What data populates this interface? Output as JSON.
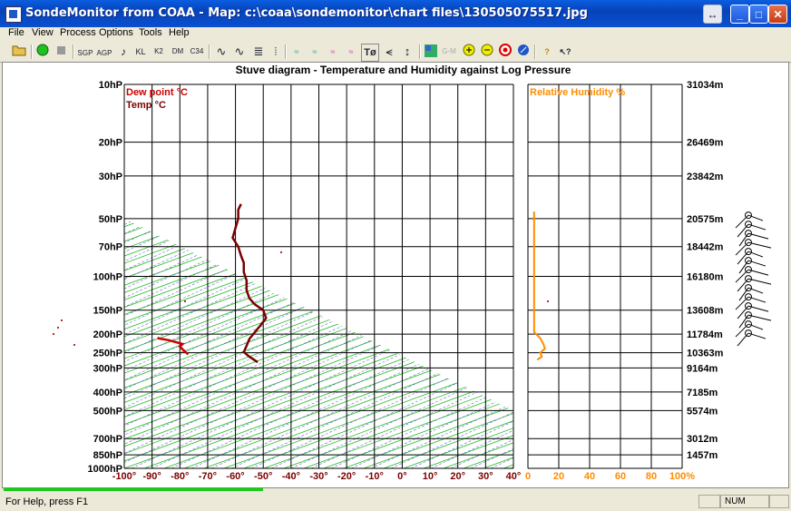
{
  "window": {
    "title": "SondeMonitor from COAA - Map: c:\\coaa\\sondemonitor\\chart files\\130505075517.jpg",
    "controls": {
      "restore": "↔",
      "minimize": "_",
      "maximize": "□",
      "close": "✕"
    }
  },
  "menu": [
    "File",
    "View",
    "Process",
    "Options",
    "Tools",
    "Help"
  ],
  "toolbar": {
    "items": [
      "open-icon",
      "start-icon",
      "stop-icon",
      "sgp-icon",
      "agp-icon",
      "sound-icon",
      "kl-icon",
      "k2-icon",
      "dm-icon",
      "c34-icon",
      "wave-icon",
      "wave2-icon",
      "lines-icon",
      "vbars-icon",
      "plot1-icon",
      "plot2-icon",
      "plot3-icon",
      "plot4-icon",
      "t-dew-icon",
      "wind-icon",
      "updown-icon",
      "map-icon",
      "gm-icon",
      "zoom-in-icon",
      "zoom-out-icon",
      "target-icon",
      "compass-icon",
      "help-icon",
      "context-help-icon"
    ],
    "labels": {
      "sgp": "SGP",
      "agp": "AGP",
      "kl": "KL",
      "k2": "K2",
      "dm": "DM",
      "c34": "C34",
      "tdew": "Tø",
      "gm": "G-M"
    }
  },
  "chart_data": {
    "type": "line",
    "title": "Stuve diagram - Temperature and Humidity against Log Pressure",
    "legend": [
      {
        "name": "Dew point °C",
        "color": "#cc0000"
      },
      {
        "name": "Temp °C",
        "color": "#7a0000"
      }
    ],
    "rh_legend": {
      "name": "Relative Humidity %",
      "color": "#ff8c00"
    },
    "y_pressure_labels": [
      "10hP",
      "20hP",
      "30hP",
      "50hP",
      "70hP",
      "100hP",
      "150hP",
      "200hP",
      "250hP",
      "300hP",
      "400hP",
      "500hP",
      "700hP",
      "850hP",
      "1000hP"
    ],
    "y_pressure_values": [
      10,
      20,
      30,
      50,
      70,
      100,
      150,
      200,
      250,
      300,
      400,
      500,
      700,
      850,
      1000
    ],
    "y_scale": "log",
    "altitude_labels": [
      "31034m",
      "26469m",
      "23842m",
      "20575m",
      "18442m",
      "16180m",
      "13608m",
      "11784m",
      "10363m",
      "9164m",
      "7185m",
      "5574m",
      "3012m",
      "1457m"
    ],
    "altitude_pressures": [
      10,
      20,
      30,
      50,
      70,
      100,
      150,
      200,
      250,
      300,
      400,
      500,
      700,
      850
    ],
    "x_temp_labels": [
      "-100°",
      "-90°",
      "-80°",
      "-70°",
      "-60°",
      "-50°",
      "-40°",
      "-30°",
      "-20°",
      "-10°",
      "0°",
      "10°",
      "20°",
      "30°",
      "40°"
    ],
    "xlim": [
      -100,
      40
    ],
    "x_rh_labels": [
      "0",
      "20",
      "40",
      "60",
      "80",
      "100%"
    ],
    "rh_xlim": [
      0,
      100
    ],
    "grid": true,
    "series": [
      {
        "name": "Temp °C",
        "color": "#7a0000",
        "points": [
          [
            -52,
            280
          ],
          [
            -55,
            262
          ],
          [
            -57,
            248
          ],
          [
            -56,
            230
          ],
          [
            -55,
            212
          ],
          [
            -53,
            195
          ],
          [
            -51,
            180
          ],
          [
            -49,
            165
          ],
          [
            -50,
            150
          ],
          [
            -53,
            140
          ],
          [
            -55,
            130
          ],
          [
            -56,
            118
          ],
          [
            -56,
            105
          ],
          [
            -57,
            95
          ],
          [
            -57,
            85
          ],
          [
            -58,
            78
          ],
          [
            -59,
            70
          ],
          [
            -61,
            63
          ],
          [
            -60,
            56
          ],
          [
            -59,
            50
          ],
          [
            -59,
            45
          ],
          [
            -58,
            42
          ]
        ]
      },
      {
        "name": "Dew point °C",
        "color": "#cc0000",
        "points": [
          [
            -77,
            255
          ],
          [
            -79,
            240
          ],
          [
            -80,
            232
          ],
          [
            -79,
            225
          ],
          [
            -84,
            215
          ],
          [
            -88,
            210
          ]
        ]
      },
      {
        "name": "Relative Humidity %",
        "color": "#ff8c00",
        "points": [
          [
            4,
            46
          ],
          [
            4,
            100
          ],
          [
            4,
            150
          ],
          [
            4,
            195
          ],
          [
            8,
            210
          ],
          [
            10,
            225
          ],
          [
            11,
            238
          ],
          [
            8,
            250
          ],
          [
            9,
            262
          ],
          [
            6,
            272
          ]
        ]
      }
    ]
  },
  "status": {
    "text": "For Help, press F1",
    "num": "NUM",
    "progress": 0.33
  }
}
